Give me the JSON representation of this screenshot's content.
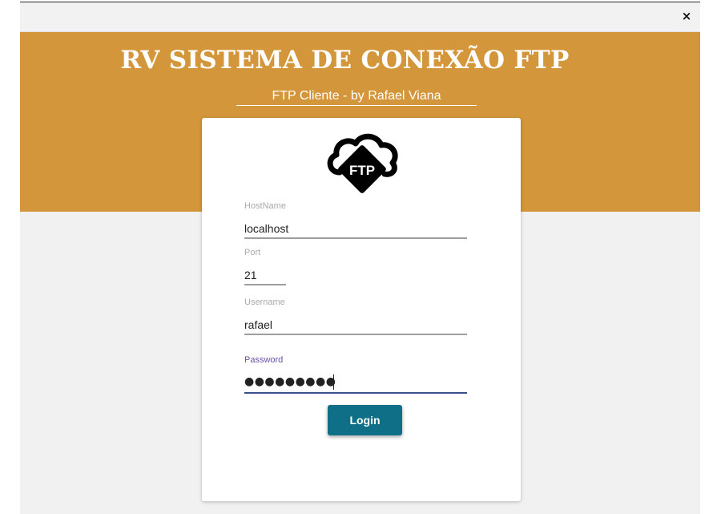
{
  "window": {
    "close_label": "×"
  },
  "header": {
    "title": "RV SISTEMA DE CONEXÃO FTP",
    "subtitle": "FTP Cliente - by Rafael Viana",
    "accent_color": "#d4963a"
  },
  "logo": {
    "icon": "ftp-cloud-icon",
    "text": "FTP"
  },
  "form": {
    "hostname": {
      "label": "HostName",
      "value": "localhost"
    },
    "port": {
      "label": "Port",
      "value": "21"
    },
    "username": {
      "label": "Username",
      "value": "rafael"
    },
    "password": {
      "label": "Password",
      "masked_value": "●●●●●●●●●"
    },
    "login_label": "Login",
    "button_color": "#0f6f86"
  }
}
